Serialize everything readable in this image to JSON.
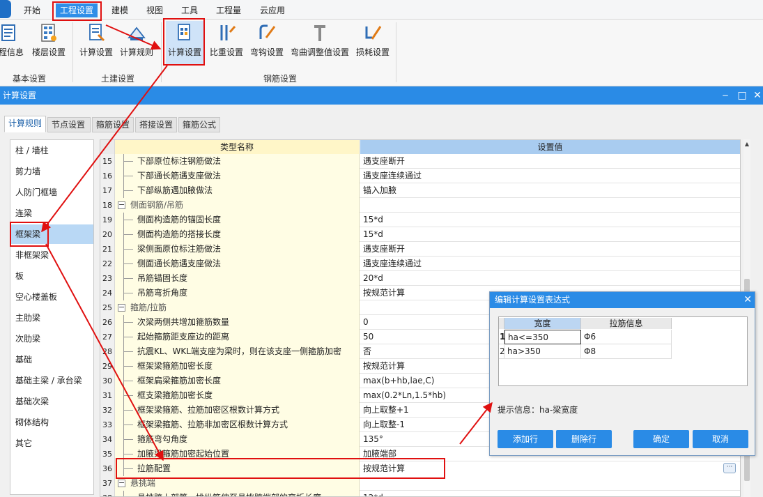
{
  "menu": {
    "items": [
      "开始",
      "工程设置",
      "建模",
      "视图",
      "工具",
      "工程量",
      "云应用"
    ],
    "active_index": 1
  },
  "ribbon": {
    "buttons": [
      {
        "label": "程信息",
        "icon": "project-info-icon"
      },
      {
        "label": "楼层设置",
        "icon": "floor-settings-icon"
      },
      {
        "label": "计算设置",
        "icon": "calc-settings-icon"
      },
      {
        "label": "计算规则",
        "icon": "calc-rules-icon"
      },
      {
        "label": "计算设置",
        "icon": "rebar-calc-settings-icon"
      },
      {
        "label": "比重设置",
        "icon": "density-settings-icon"
      },
      {
        "label": "弯钩设置",
        "icon": "hook-settings-icon"
      },
      {
        "label": "弯曲调整值设置",
        "icon": "bend-adjust-icon"
      },
      {
        "label": "损耗设置",
        "icon": "loss-settings-icon"
      }
    ],
    "groups": [
      "基本设置",
      "土建设置",
      "钢筋设置"
    ]
  },
  "dialog": {
    "title": "计算设置",
    "tabs": [
      "计算规则",
      "节点设置",
      "箍筋设置",
      "搭接设置",
      "箍筋公式"
    ],
    "active_tab": 0,
    "categories": [
      "柱 / 墙柱",
      "剪力墙",
      "人防门框墙",
      "连梁",
      "框架梁",
      "非框架梁",
      "板",
      "空心楼盖板",
      "主肋梁",
      "次肋梁",
      "基础",
      "基础主梁 / 承台梁",
      "基础次梁",
      "砌体结构",
      "其它"
    ],
    "selected_category": 4,
    "grid": {
      "col_name": "类型名称",
      "col_value": "设置值",
      "rows": [
        {
          "num": "15",
          "name": "下部原位标注钢筋做法",
          "value": "遇支座断开",
          "group": false
        },
        {
          "num": "16",
          "name": "下部通长筋遇支座做法",
          "value": "遇支座连续通过",
          "group": false
        },
        {
          "num": "17",
          "name": "下部纵筋遇加腋做法",
          "value": "锚入加腋",
          "group": false
        },
        {
          "num": "18",
          "name": "侧面钢筋/吊筋",
          "value": "",
          "group": true
        },
        {
          "num": "19",
          "name": "侧面构造筋的锚固长度",
          "value": "15*d",
          "group": false
        },
        {
          "num": "20",
          "name": "侧面构造筋的搭接长度",
          "value": "15*d",
          "group": false
        },
        {
          "num": "21",
          "name": "梁侧面原位标注筋做法",
          "value": "遇支座断开",
          "group": false
        },
        {
          "num": "22",
          "name": "侧面通长筋遇支座做法",
          "value": "遇支座连续通过",
          "group": false
        },
        {
          "num": "23",
          "name": "吊筋锚固长度",
          "value": "20*d",
          "group": false
        },
        {
          "num": "24",
          "name": "吊筋弯折角度",
          "value": "按规范计算",
          "group": false
        },
        {
          "num": "25",
          "name": "箍筋/拉筋",
          "value": "",
          "group": true
        },
        {
          "num": "26",
          "name": "次梁两侧共增加箍筋数量",
          "value": "0",
          "group": false
        },
        {
          "num": "27",
          "name": "起始箍筋距支座边的距离",
          "value": "50",
          "group": false
        },
        {
          "num": "28",
          "name": "抗震KL、WKL端支座为梁时，则在该支座一侧箍筋加密",
          "value": "否",
          "group": false
        },
        {
          "num": "29",
          "name": "框架梁箍筋加密长度",
          "value": "按规范计算",
          "group": false
        },
        {
          "num": "30",
          "name": "框架扁梁箍筋加密长度",
          "value": "max(b+hb,lae,C)",
          "group": false
        },
        {
          "num": "31",
          "name": "框支梁箍筋加密长度",
          "value": "max(0.2*Ln,1.5*hb)",
          "group": false
        },
        {
          "num": "32",
          "name": "框架梁箍筋、拉筋加密区根数计算方式",
          "value": "向上取整+1",
          "group": false
        },
        {
          "num": "33",
          "name": "框架梁箍筋、拉筋非加密区根数计算方式",
          "value": "向上取整-1",
          "group": false
        },
        {
          "num": "34",
          "name": "箍筋弯勾角度",
          "value": "135°",
          "group": false
        },
        {
          "num": "35",
          "name": "加腋梁箍筋加密起始位置",
          "value": "加腋端部",
          "group": false
        },
        {
          "num": "36",
          "name": "拉筋配置",
          "value": "按规范计算",
          "group": false,
          "selected": true
        },
        {
          "num": "37",
          "name": "悬挑端",
          "value": "",
          "group": true
        },
        {
          "num": "38",
          "name": "悬挑跨上部第一排纵筋伸至悬挑跨端部的弯折长度",
          "value": "12*d",
          "group": false
        }
      ]
    }
  },
  "popup": {
    "title": "编辑计算设置表达式",
    "col1": "宽度",
    "col2": "拉筋信息",
    "rows": [
      {
        "num": "1",
        "width": "ha<=350",
        "info": "Φ6"
      },
      {
        "num": "2",
        "width": "ha>350",
        "info": "Φ8"
      }
    ],
    "hint": "提示信息：ha-梁宽度",
    "buttons": {
      "add": "添加行",
      "delete": "删除行",
      "ok": "确定",
      "cancel": "取消"
    }
  },
  "colors": {
    "accent": "#2a8be6",
    "annotation": "#e01010",
    "grid_name_bg": "#fffde4",
    "selected_item": "#b9d8f5"
  }
}
